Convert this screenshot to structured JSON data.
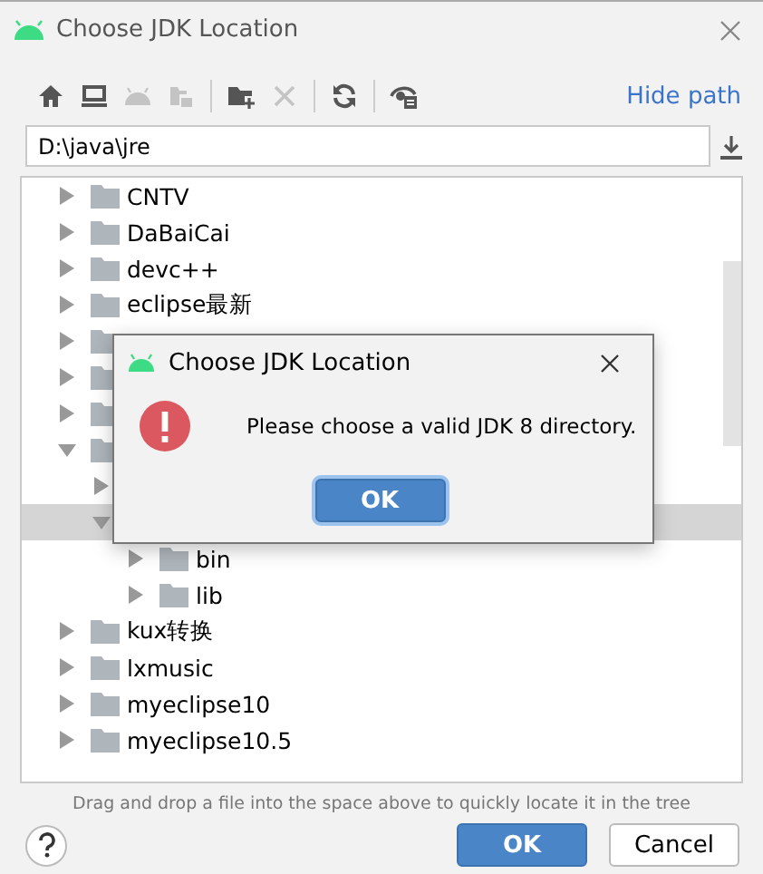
{
  "window": {
    "title": "Choose JDK Location"
  },
  "toolbar": {
    "groups": [
      [
        {
          "kind": "home",
          "disabled": false
        },
        {
          "kind": "desktop",
          "disabled": false
        },
        {
          "kind": "android",
          "disabled": true
        },
        {
          "kind": "module",
          "disabled": true
        }
      ],
      [
        {
          "kind": "new-folder",
          "disabled": false
        },
        {
          "kind": "delete",
          "disabled": true
        }
      ],
      [
        {
          "kind": "refresh",
          "disabled": false
        }
      ],
      [
        {
          "kind": "show-hidden",
          "disabled": false
        }
      ]
    ],
    "hide_path": "Hide path"
  },
  "path": {
    "value": "D:\\java\\jre"
  },
  "tree": [
    {
      "label": "CNTV",
      "expanded": false,
      "selected": false
    },
    {
      "label": "DaBaiCai",
      "expanded": false,
      "selected": false
    },
    {
      "label": "devc++",
      "expanded": false,
      "selected": false
    },
    {
      "label": "eclipse最新",
      "expanded": false,
      "selected": false
    },
    {
      "expanded": false,
      "selected": false
    },
    {
      "expanded": false,
      "selected": false
    },
    {
      "expanded": false,
      "selected": false
    },
    {
      "expanded": true,
      "selected": false,
      "children": [
        {
          "expanded": false,
          "selected": false
        },
        {
          "expanded": true,
          "selected": true,
          "children": [
            {
              "label": "bin",
              "expanded": false,
              "selected": false
            },
            {
              "label": "lib",
              "expanded": false,
              "selected": false
            }
          ]
        }
      ]
    },
    {
      "label": "kux转换",
      "expanded": false,
      "selected": false
    },
    {
      "label": "lxmusic",
      "expanded": false,
      "selected": false
    },
    {
      "label": "myeclipse10",
      "expanded": false,
      "selected": false
    },
    {
      "label": "myeclipse10.5",
      "expanded": false,
      "selected": false
    }
  ],
  "hint": "Drag and drop a file into the space above to quickly locate it in the tree",
  "buttons": {
    "ok": "OK",
    "cancel": "Cancel"
  },
  "modal": {
    "title": "Choose JDK Location",
    "message": "Please choose a valid JDK 8 directory.",
    "button": "OK"
  }
}
